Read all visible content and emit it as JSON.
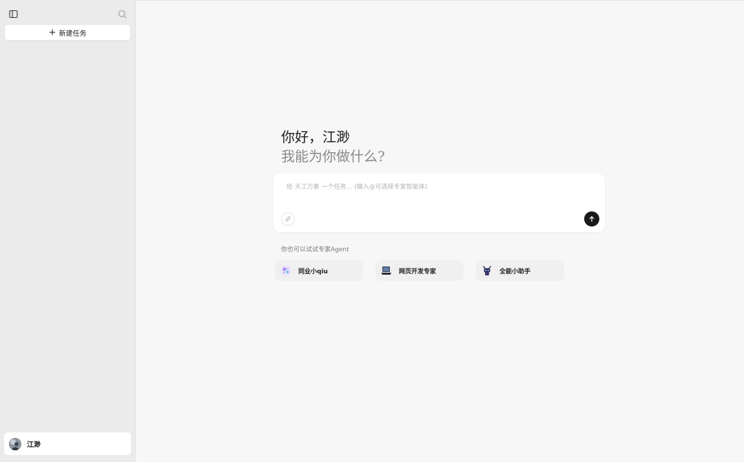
{
  "sidebar": {
    "toggle_icon": "sidebar-toggle-icon",
    "search_icon": "search-icon",
    "new_task_label": "新建任务",
    "user": {
      "name": "江渺"
    }
  },
  "main": {
    "greeting_line1": "你好，江渺",
    "greeting_line2": "我能为你做什么?",
    "input": {
      "value": "",
      "placeholder": "给 天工万象 一个任务... (输入@可选择专家智能体)"
    },
    "agents_label": "你也可以试试专家Agent",
    "agents": [
      {
        "label": "同业小qiu",
        "icon": "sparkle-agent-icon"
      },
      {
        "label": "网页开发专家",
        "icon": "laptop-agent-icon"
      },
      {
        "label": "全能小助手",
        "icon": "robot-agent-icon"
      }
    ]
  },
  "colors": {
    "sidebar_bg": "#ebebeb",
    "main_bg": "#f7f7f7",
    "send_button": "#1a1a1a",
    "muted_text": "#8a8a8a"
  }
}
